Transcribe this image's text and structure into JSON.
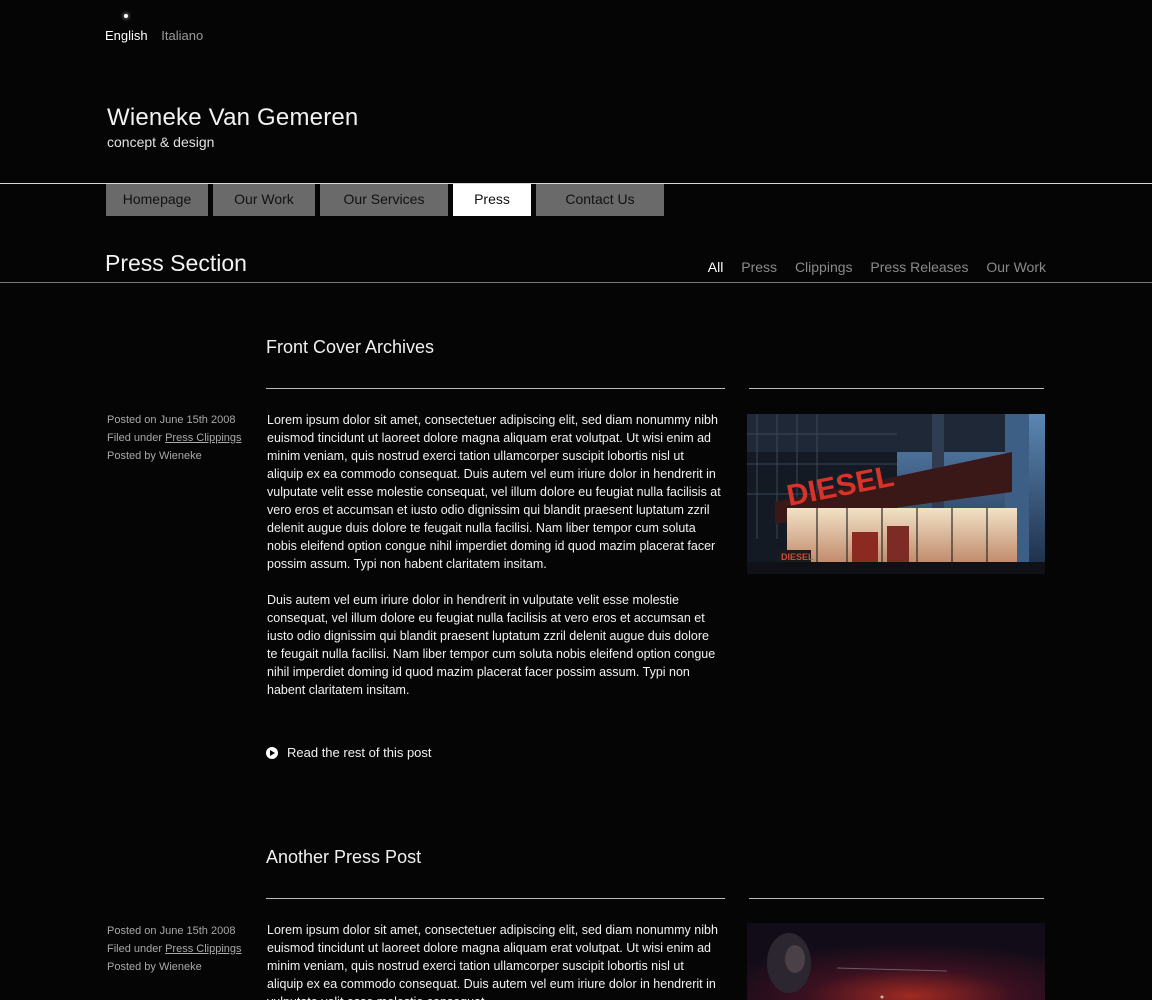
{
  "language": {
    "active": "English",
    "other": "Italiano"
  },
  "brand": {
    "name": "Wieneke Van Gemeren",
    "tagline": "concept & design"
  },
  "nav": {
    "items": [
      "Homepage",
      "Our Work",
      "Our Services",
      "Press",
      "Contact Us"
    ],
    "active": "Press"
  },
  "section": {
    "title": "Press Section",
    "filters": [
      "All",
      "Press",
      "Clippings",
      "Press Releases",
      "Our Work"
    ],
    "active_filter": "All"
  },
  "posts": [
    {
      "title": "Front Cover Archives",
      "meta_posted_on": "Posted on June 15th 2008",
      "meta_filed_prefix": "Filed under ",
      "meta_filed_link": "Press Clippings",
      "meta_posted_by": "Posted by Wieneke",
      "paragraph1": "Lorem ipsum dolor sit amet, consectetuer adipiscing elit, sed diam nonummy nibh euismod tincidunt ut laoreet dolore magna aliquam erat volutpat. Ut wisi enim ad minim veniam, quis nostrud exerci tation ullamcorper suscipit lobortis nisl ut aliquip ex ea commodo consequat. Duis autem vel eum iriure dolor in hendrerit in vulputate velit esse molestie consequat, vel illum dolore eu feugiat nulla facilisis at vero eros et accumsan et iusto odio dignissim qui blandit praesent luptatum zzril delenit augue duis dolore te feugait nulla facilisi. Nam liber tempor cum soluta nobis eleifend option congue nihil imperdiet doming id quod mazim placerat facer possim assum. Typi non habent claritatem insitam.",
      "paragraph2": "Duis autem vel eum iriure dolor in hendrerit in vulputate velit esse molestie consequat, vel illum dolore eu feugiat nulla facilisis at vero eros et accumsan et iusto odio dignissim qui blandit praesent luptatum zzril delenit augue duis dolore te feugait nulla facilisi. Nam liber tempor cum soluta nobis eleifend option congue nihil imperdiet doming id quod mazim placerat facer possim assum. Typi non habent claritatem insitam.",
      "read_more": "Read the rest of this post",
      "photo_sign": "DIESEL",
      "photo_small_sign": "DIESEL"
    },
    {
      "title": "Another Press Post",
      "meta_posted_on": "Posted on June 15th 2008",
      "meta_filed_prefix": "Filed under ",
      "meta_filed_link": "Press Clippings",
      "meta_posted_by": "Posted by Wieneke",
      "paragraph1": "Lorem ipsum dolor sit amet, consectetuer adipiscing elit, sed diam nonummy nibh euismod tincidunt ut laoreet dolore magna aliquam erat volutpat. Ut wisi enim ad minim veniam, quis nostrud exerci tation ullamcorper suscipit lobortis nisl ut aliquip ex ea commodo consequat. Duis autem vel eum iriure dolor in hendrerit in vulputate velit esse molestie consequat."
    }
  ]
}
